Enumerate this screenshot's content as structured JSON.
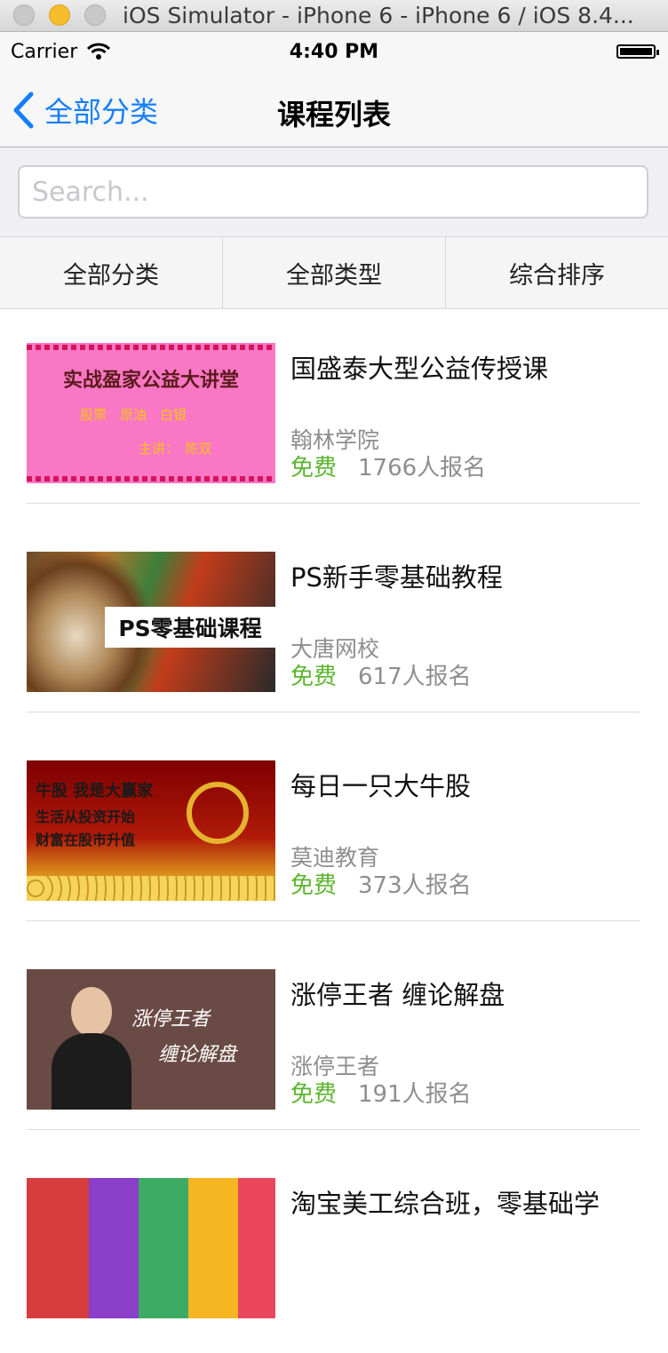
{
  "window": {
    "title": "iOS Simulator - iPhone 6 - iPhone 6 / iOS 8.4..."
  },
  "status_bar": {
    "carrier": "Carrier",
    "time": "4:40 PM"
  },
  "nav": {
    "back_label": "全部分类",
    "title": "课程列表"
  },
  "search": {
    "placeholder": "Search...",
    "value": ""
  },
  "filters": [
    "全部分类",
    "全部类型",
    "综合排序"
  ],
  "courses": [
    {
      "title": "国盛泰大型公益传授课",
      "school": "翰林学院",
      "price": "免费",
      "enrolled": "1766人报名",
      "thumb_text": [
        "实战盈家公益大讲堂",
        "股票　原油　白银",
        "主讲：　陈双"
      ]
    },
    {
      "title": "PS新手零基础教程",
      "school": "大唐网校",
      "price": "免费",
      "enrolled": "617人报名",
      "thumb_text": [
        "PS零基础课程"
      ]
    },
    {
      "title": "每日一只大牛股",
      "school": "莫迪教育",
      "price": "免费",
      "enrolled": "373人报名",
      "thumb_text": [
        "牛股 我是大赢家",
        "生活从投资开始",
        "财富在股市升值"
      ]
    },
    {
      "title": "涨停王者 缠论解盘",
      "school": "涨停王者",
      "price": "免费",
      "enrolled": "191人报名",
      "thumb_text": [
        "涨停王者",
        "缠论解盘"
      ]
    },
    {
      "title": "淘宝美工综合班，零基础学"
    }
  ],
  "colors": {
    "accent": "#157efb",
    "free": "#5bb52f"
  }
}
